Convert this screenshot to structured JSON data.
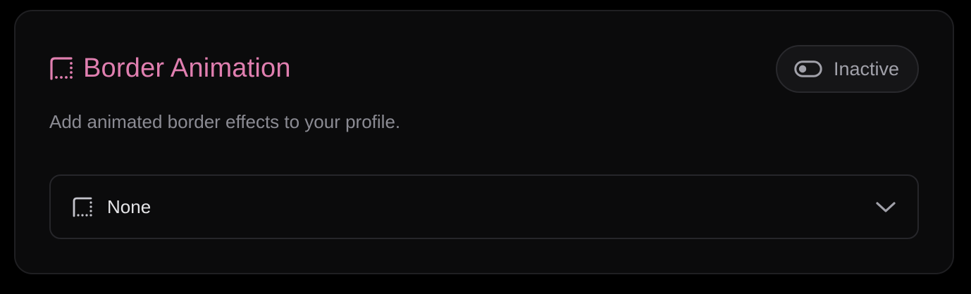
{
  "card": {
    "title": "Border Animation",
    "title_icon": "border-dotted-icon",
    "description": "Add animated border effects to your profile.",
    "toggle": {
      "label": "Inactive",
      "icon": "toggle-off-icon",
      "active": false
    },
    "select": {
      "value": "None",
      "icon": "border-dotted-icon",
      "chevron": "chevron-down-icon"
    }
  },
  "colors": {
    "accent": "#e07fb0",
    "card_bg": "#0b0b0c",
    "border": "#1f1f22",
    "muted_text": "#8b8b93",
    "toggle_text": "#a1a1aa",
    "value_text": "#e4e4e7"
  }
}
